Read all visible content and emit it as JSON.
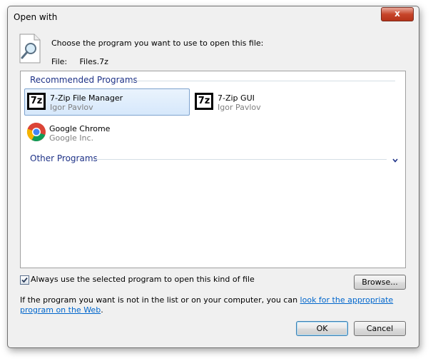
{
  "window": {
    "title": "Open with",
    "close_label": "x"
  },
  "header": {
    "prompt": "Choose the program you want to use to open this file:",
    "file_label": "File:",
    "file_name": "Files.7z"
  },
  "recommended": {
    "title": "Recommended Programs",
    "programs": [
      {
        "name": "7-Zip File Manager",
        "publisher": "Igor Pavlov",
        "icon": "7zip-icon",
        "selected": true
      },
      {
        "name": "7-Zip GUI",
        "publisher": "Igor Pavlov",
        "icon": "7zip-icon",
        "selected": false
      },
      {
        "name": "Google Chrome",
        "publisher": "Google Inc.",
        "icon": "chrome-icon",
        "selected": false
      }
    ],
    "sevenzip_icon_text": "7z"
  },
  "other": {
    "title": "Other Programs"
  },
  "options": {
    "always_use_label": "Always use the selected program to open this kind of file",
    "always_use_checked": true
  },
  "buttons": {
    "browse": "Browse...",
    "ok": "OK",
    "cancel": "Cancel"
  },
  "help": {
    "text_before": "If the program you want is not in the list or on your computer, you can ",
    "link_text": "look for the appropriate program on the Web",
    "text_after": "."
  },
  "colors": {
    "group_header": "#1e3287",
    "link": "#0066cc",
    "close_button": "#c7452a"
  }
}
